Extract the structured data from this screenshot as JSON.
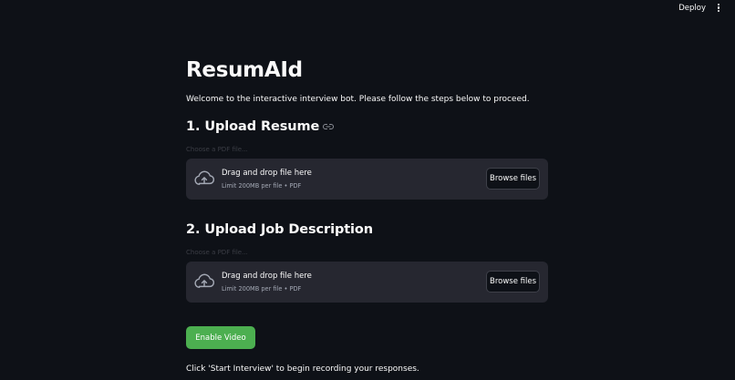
{
  "header": {
    "deploy_label": "Deploy",
    "menu_icon": "kebab-menu-icon"
  },
  "main": {
    "title": "ResumAId",
    "welcome_text": "Welcome to the interactive interview bot. Please follow the steps below to proceed.",
    "sections": [
      {
        "heading": "1. Upload Resume",
        "has_link_icon": true,
        "uploader_label": "Choose a PDF file...",
        "dropzone_text": "Drag and drop file here",
        "dropzone_limit": "Limit 200MB per file • PDF",
        "browse_label": "Browse files"
      },
      {
        "heading": "2. Upload Job Description",
        "uploader_label": "Choose a PDF file...",
        "dropzone_text": "Drag and drop file here",
        "dropzone_limit": "Limit 200MB per file • PDF",
        "browse_label": "Browse files"
      }
    ],
    "enable_video_label": "Enable Video",
    "instruction_text": "Click 'Start Interview' to begin recording your responses."
  },
  "colors": {
    "background": "#0e1117",
    "dropzone": "#262730",
    "primary_button": "#4caf50"
  }
}
